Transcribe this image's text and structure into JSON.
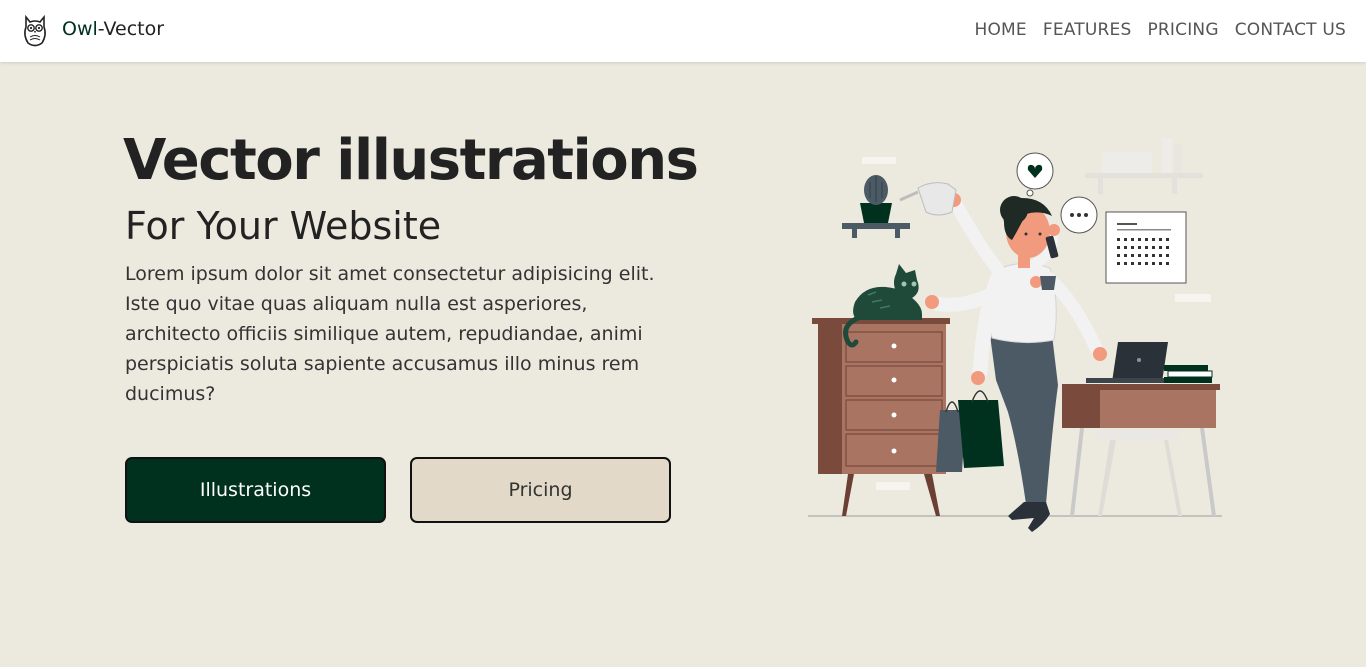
{
  "brand": {
    "strong": "Owl",
    "rest": "-Vector"
  },
  "nav": [
    {
      "label": "HOME"
    },
    {
      "label": "FEATURES"
    },
    {
      "label": "PRICING"
    },
    {
      "label": "CONTACT US"
    }
  ],
  "hero": {
    "title": "Vector illustrations",
    "subtitle": "For Your Website",
    "description": "Lorem ipsum dolor sit amet consectetur adipisicing elit. Iste quo vitae quas aliquam nulla est asperiores, architecto officiis similique autem, repudiandae, animi perspiciatis soluta sapiente accusamus illo minus rem ducimus?",
    "primary_button": "Illustrations",
    "secondary_button": "Pricing"
  },
  "icons": {
    "logo": "owl-icon",
    "illustration": "multitasking-woman-illustration"
  },
  "colors": {
    "accent": "#00301e",
    "background": "#ece9df",
    "secondary_button": "#e2d9c8"
  }
}
